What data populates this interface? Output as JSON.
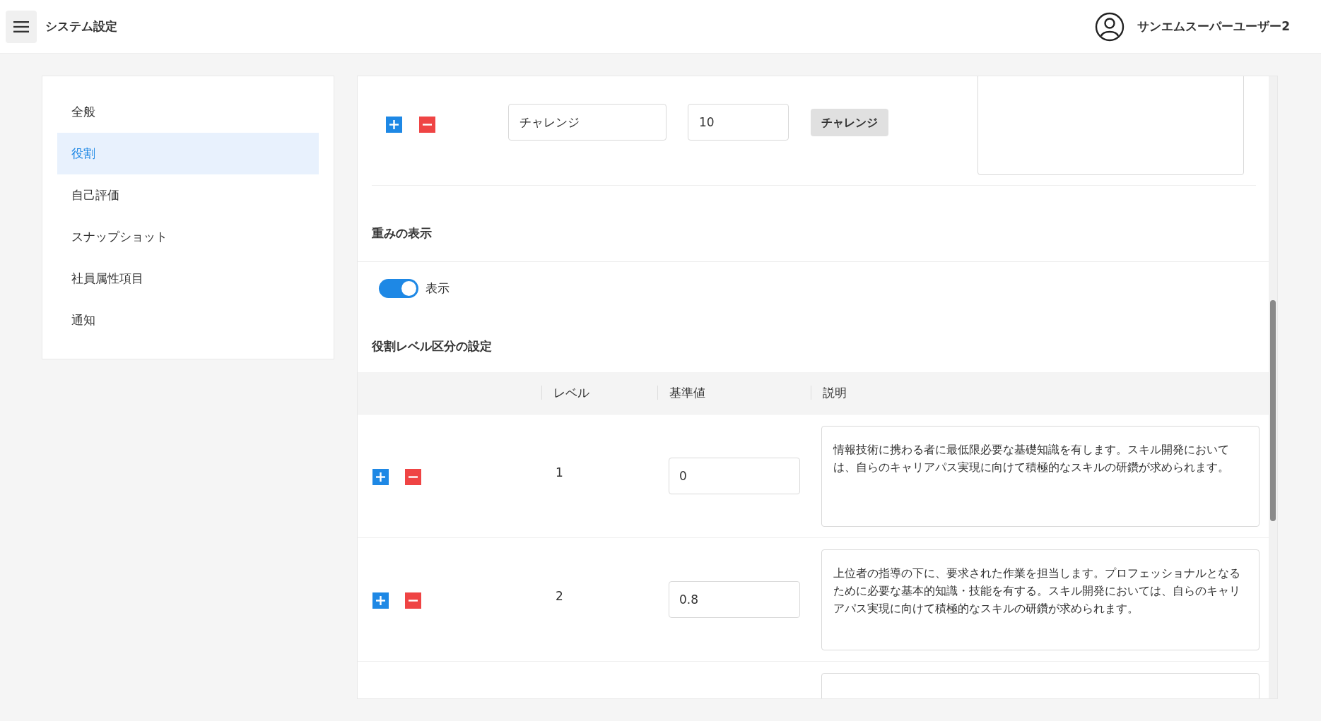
{
  "header": {
    "title": "システム設定",
    "user": "サンエムスーパーユーザー2"
  },
  "sidebar": {
    "items": [
      {
        "label": "全般",
        "selected": false
      },
      {
        "label": "役割",
        "selected": true
      },
      {
        "label": "自己評価",
        "selected": false
      },
      {
        "label": "スナップショット",
        "selected": false
      },
      {
        "label": "社員属性項目",
        "selected": false
      },
      {
        "label": "通知",
        "selected": false
      }
    ]
  },
  "role_row": {
    "name": "チャレンジ",
    "value": "10",
    "preview": "チャレンジ"
  },
  "weight_section": {
    "title": "重みの表示",
    "toggle": {
      "label": "表示",
      "on": true
    }
  },
  "level_section": {
    "title": "役割レベル区分の設定",
    "columns": [
      "レベル",
      "基準値",
      "説明"
    ],
    "rows": [
      {
        "kind": "level",
        "level": "1",
        "value": "0",
        "description": "情報技術に携わる者に最低限必要な基礎知識を有します。スキル開発においては、自らのキャリアパス実現に向けて積極的なスキルの研鑽が求められます。"
      },
      {
        "kind": "level",
        "level": "2",
        "value": "0.8",
        "description": "上位者の指導の下に、要求された作業を担当します。プロフェッショナルとなるために必要な基本的知識・技能を有する。スキル開発においては、自らのキャリアパス実現に向けて積極的なスキルの研鑽が求められます。"
      },
      {
        "kind": "cut"
      }
    ]
  }
}
